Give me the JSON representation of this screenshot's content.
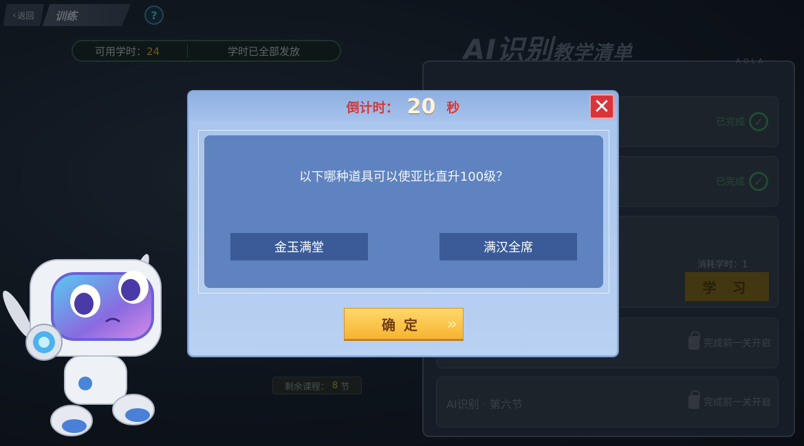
{
  "topbar": {
    "back_label": "返回",
    "title": "训练",
    "help": "?"
  },
  "hours": {
    "label": "可用学时：",
    "value": "24",
    "status": "学时已全部发放"
  },
  "panel": {
    "title_main": "AI识别",
    "title_sub": "教学清单",
    "brand": "AOLA",
    "lessons": [
      {
        "status": "已完成"
      },
      {
        "status": "已完成"
      },
      {
        "cost_label": "消耗学时：1",
        "action": "学 习"
      },
      {
        "locked": "完成前一关开启"
      },
      {
        "name": "AI识别 · 第六节",
        "locked": "完成前一关开启"
      }
    ]
  },
  "remain": {
    "label_pre": "剩余课程：",
    "value": "8",
    "unit": "节"
  },
  "dialog": {
    "countdown_label": "倒计时：",
    "countdown_value": "20",
    "countdown_unit": "秒",
    "question": "以下哪种道具可以使亚比直升100级？",
    "options": [
      "金玉满堂",
      "满汉全席"
    ],
    "confirm": "确定"
  }
}
